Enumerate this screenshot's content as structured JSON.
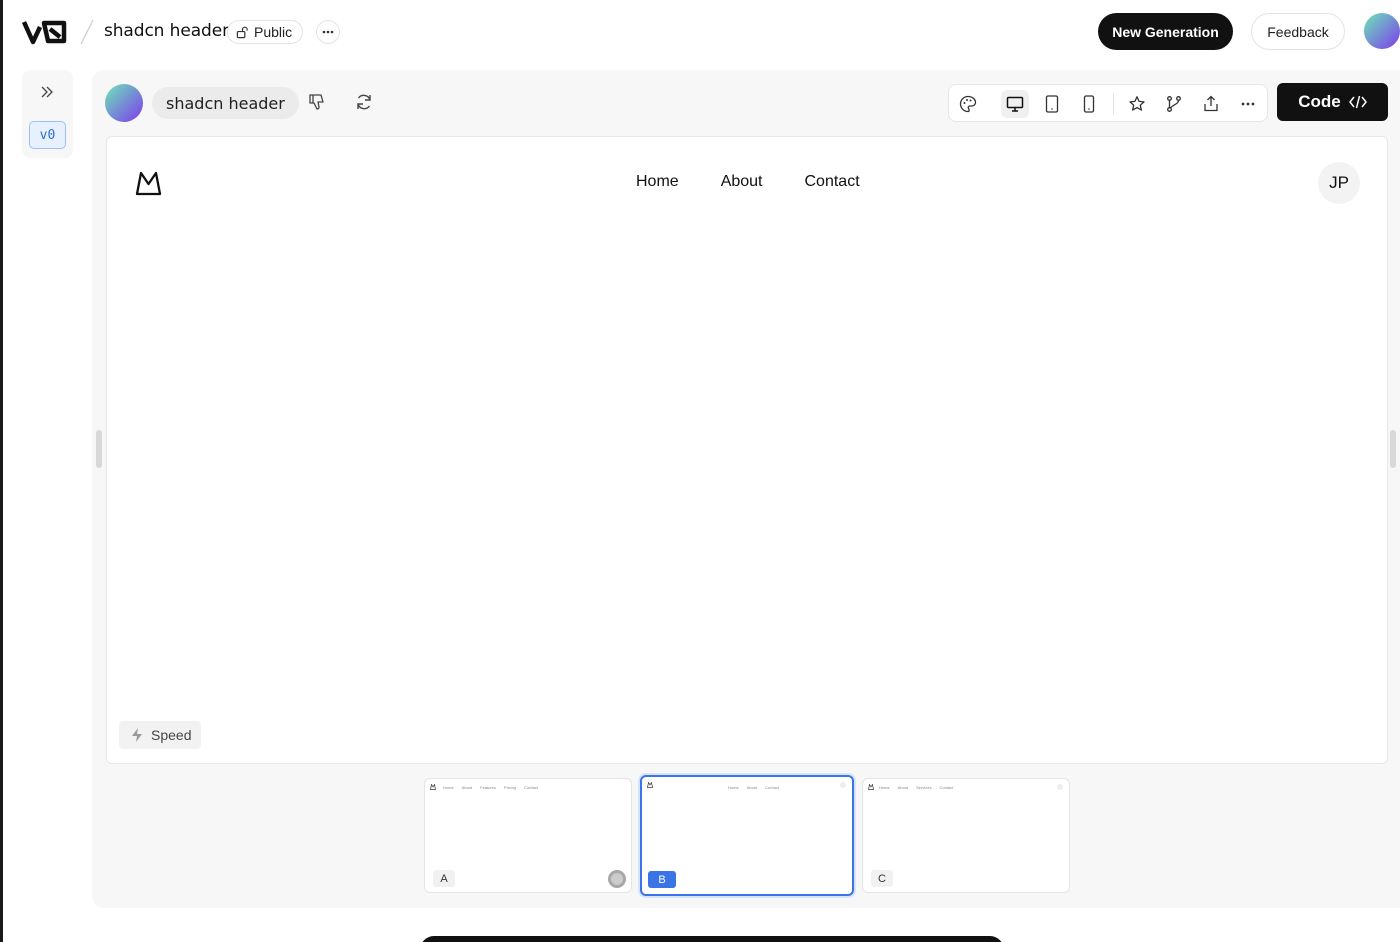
{
  "topbar": {
    "project_name": "shadcn header",
    "visibility": "Public",
    "new_generation_label": "New Generation",
    "feedback_label": "Feedback"
  },
  "sidebar": {
    "version_label": "v0"
  },
  "prompt": {
    "text": "shadcn header"
  },
  "toolbar": {
    "code_label": "Code",
    "icons": [
      "palette-icon",
      "desktop-icon",
      "tablet-icon",
      "mobile-icon",
      "star-icon",
      "fork-icon",
      "share-icon",
      "more-icon"
    ],
    "active_device": "desktop"
  },
  "preview": {
    "nav": [
      "Home",
      "About",
      "Contact"
    ],
    "avatar_initials": "JP",
    "speed_label": "Speed"
  },
  "thumbnails": [
    {
      "label": "A",
      "selected": false,
      "nav": [
        "Home",
        "About",
        "Features",
        "Pricing",
        "Contact"
      ]
    },
    {
      "label": "B",
      "selected": true,
      "nav": [
        "Home",
        "About",
        "Contact"
      ]
    },
    {
      "label": "C",
      "selected": false,
      "nav": [
        "Home",
        "About",
        "Services",
        "Contact"
      ]
    }
  ],
  "colors": {
    "accent": "#3b74e6",
    "primary_button": "#111111"
  }
}
